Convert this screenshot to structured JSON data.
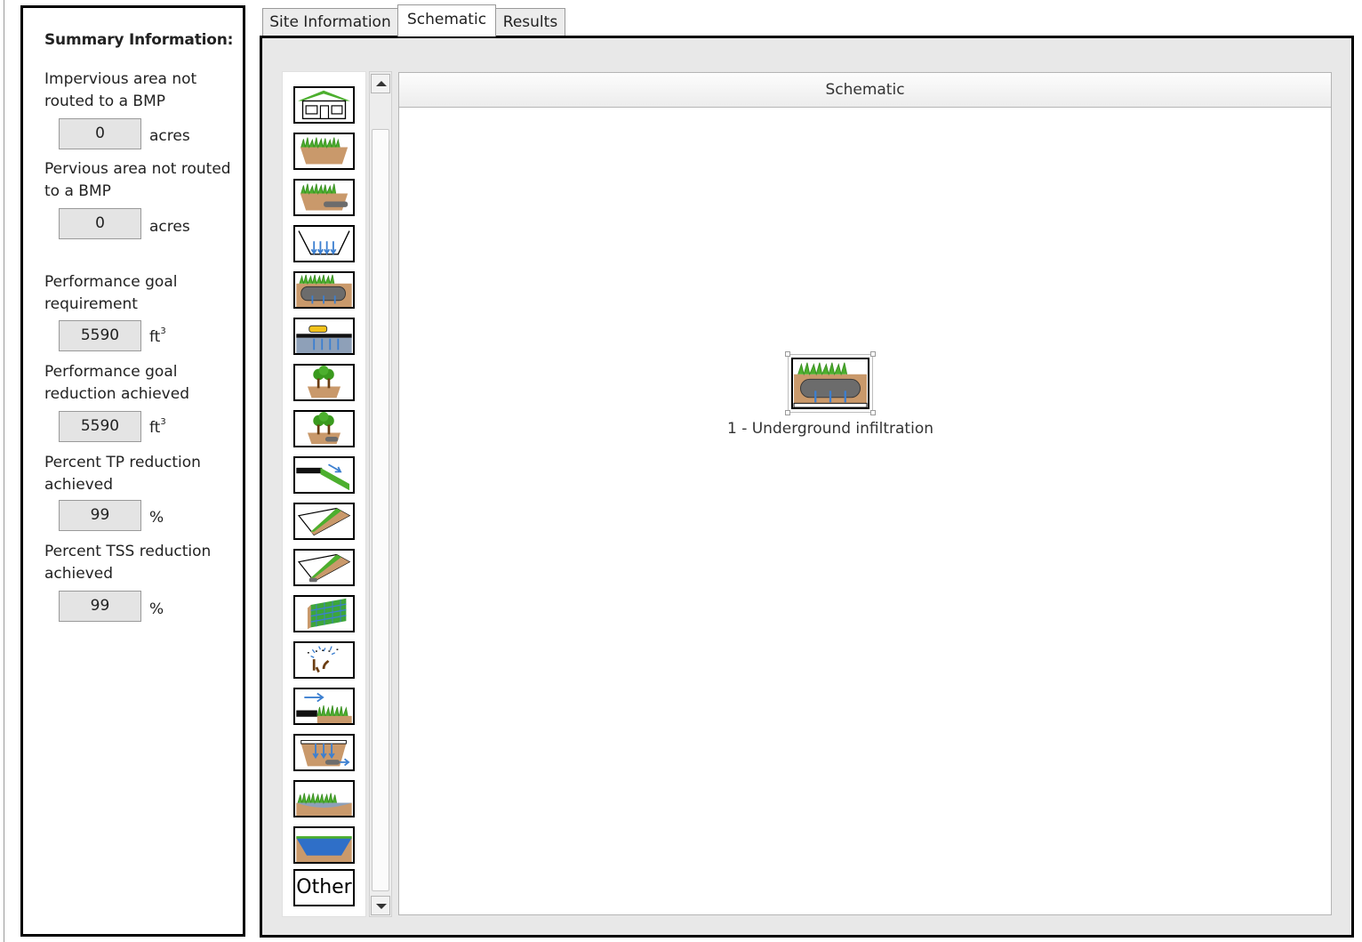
{
  "summary": {
    "title": "Summary Information:",
    "impervious_label": "Impervious area not routed to a BMP",
    "impervious_value": "0",
    "impervious_unit": "acres",
    "pervious_label": "Pervious area not routed to a BMP",
    "pervious_value": "0",
    "pervious_unit": "acres",
    "goal_req_label": "Performance goal requirement",
    "goal_req_value": "5590",
    "goal_req_unit": "ft",
    "goal_ach_label": "Performance goal reduction achieved",
    "goal_ach_value": "5590",
    "goal_ach_unit": "ft",
    "volume_unit_exponent": "3",
    "tp_label": "Percent TP reduction achieved",
    "tp_value": "99",
    "tp_unit": "%",
    "tss_label": "Percent TSS reduction achieved",
    "tss_value": "99",
    "tss_unit": "%"
  },
  "tabs": [
    {
      "label": "Site Information",
      "active": false
    },
    {
      "label": "Schematic",
      "active": true
    },
    {
      "label": "Results",
      "active": false
    }
  ],
  "palette": {
    "tools": [
      "watershed-icon",
      "bioretention-icon",
      "bioretention-underdrain-icon",
      "infiltration-basin-icon",
      "underground-infiltration-icon",
      "permeable-pavement-icon",
      "tree-trench-icon",
      "tree-trench-underdrain-icon",
      "green-roof-icon",
      "swale-icon",
      "swale-underdrain-icon",
      "filter-strip-icon",
      "harvest-reuse-icon",
      "vegetated-filter-icon",
      "sand-filter-icon",
      "wet-swale-icon",
      "pond-icon"
    ],
    "other_label": "Other"
  },
  "canvas": {
    "header": "Schematic",
    "node_label": "1 - Underground infiltration"
  },
  "colors": {
    "grass": "#4caf2e",
    "soil": "#c9996b",
    "water": "#3c7fd0",
    "pipe": "#6c6c6c",
    "border": "#000000"
  }
}
